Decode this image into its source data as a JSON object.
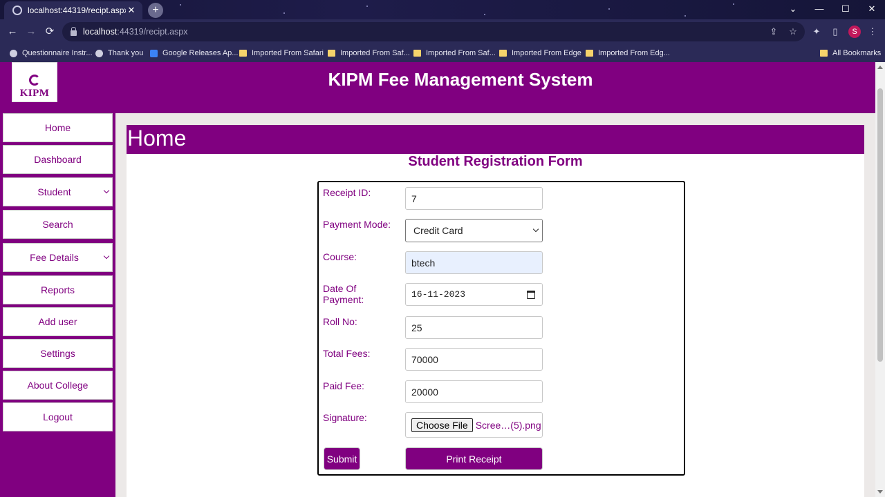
{
  "browser": {
    "tab_title": "localhost:44319/recipt.aspx",
    "tab_close": "✕",
    "new_tab": "+",
    "url_host": "localhost",
    "url_path": ":44319/recipt.aspx",
    "nav_back": "←",
    "nav_forward": "→",
    "reload": "⟳",
    "profile_initial": "S",
    "window_controls": {
      "tab_search": "⌄",
      "minimize": "—",
      "maximize": "☐",
      "close": "✕"
    },
    "bookmarks": [
      {
        "label": "Questionnaire Instr...",
        "icon": "globe-icon"
      },
      {
        "label": "Thank you",
        "icon": "globe-icon"
      },
      {
        "label": "Google Releases Ap...",
        "icon": "google-icon"
      },
      {
        "label": "Imported From Safari",
        "icon": "folder-icon"
      },
      {
        "label": "Imported From Saf...",
        "icon": "folder-icon"
      },
      {
        "label": "Imported From Saf...",
        "icon": "folder-icon"
      },
      {
        "label": "Imported From Edge",
        "icon": "folder-icon"
      },
      {
        "label": "Imported From Edg...",
        "icon": "folder-icon"
      }
    ],
    "all_bookmarks": "All Bookmarks"
  },
  "header": {
    "logo_text": "KIPM",
    "brand_title": "KIPM Fee Management System"
  },
  "sidebar": {
    "items": [
      {
        "label": "Home",
        "dropdown": false
      },
      {
        "label": "Dashboard",
        "dropdown": false
      },
      {
        "label": "Student",
        "dropdown": true
      },
      {
        "label": "Search",
        "dropdown": false
      },
      {
        "label": "Fee Details",
        "dropdown": true
      },
      {
        "label": "Reports",
        "dropdown": false
      },
      {
        "label": "Add user",
        "dropdown": false
      },
      {
        "label": "Settings",
        "dropdown": false
      },
      {
        "label": "About College",
        "dropdown": false
      },
      {
        "label": "Logout",
        "dropdown": false
      }
    ]
  },
  "main": {
    "page_title": "Home",
    "form_title": "Student Registration Form",
    "fields": {
      "receipt_id": {
        "label": "Receipt ID:",
        "value": "7"
      },
      "payment_mode": {
        "label": "Payment Mode:",
        "value": "Credit Card"
      },
      "course": {
        "label": "Course:",
        "value": "btech"
      },
      "date_of_payment": {
        "label": "Date Of Payment:",
        "value": "16-11-2023"
      },
      "roll_no": {
        "label": "Roll No:",
        "value": "25"
      },
      "total_fees": {
        "label": "Total Fees:",
        "value": "70000"
      },
      "paid_fee": {
        "label": "Paid Fee:",
        "value": "20000"
      },
      "signature": {
        "label": "Signature:",
        "button": "Choose File",
        "file_name": "Scree…(5).png"
      }
    },
    "submit_label": "Submit",
    "print_label": "Print Receipt"
  },
  "colors": {
    "brand_purple": "#800080",
    "chrome_dark": "#2b2a57",
    "autofill_blue": "#e8f0fe"
  }
}
